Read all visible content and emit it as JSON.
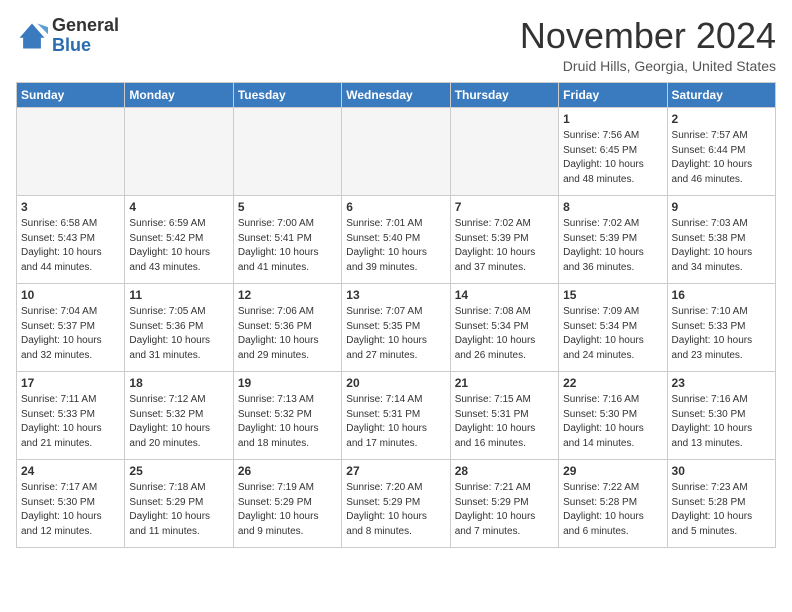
{
  "logo": {
    "general": "General",
    "blue": "Blue"
  },
  "header": {
    "month": "November 2024",
    "location": "Druid Hills, Georgia, United States"
  },
  "weekdays": [
    "Sunday",
    "Monday",
    "Tuesday",
    "Wednesday",
    "Thursday",
    "Friday",
    "Saturday"
  ],
  "weeks": [
    [
      {
        "day": null
      },
      {
        "day": null
      },
      {
        "day": null
      },
      {
        "day": null
      },
      {
        "day": null
      },
      {
        "day": 1,
        "sunrise": "7:56 AM",
        "sunset": "6:45 PM",
        "daylight": "10 hours and 48 minutes."
      },
      {
        "day": 2,
        "sunrise": "7:57 AM",
        "sunset": "6:44 PM",
        "daylight": "10 hours and 46 minutes."
      }
    ],
    [
      {
        "day": 3,
        "sunrise": "6:58 AM",
        "sunset": "5:43 PM",
        "daylight": "10 hours and 44 minutes."
      },
      {
        "day": 4,
        "sunrise": "6:59 AM",
        "sunset": "5:42 PM",
        "daylight": "10 hours and 43 minutes."
      },
      {
        "day": 5,
        "sunrise": "7:00 AM",
        "sunset": "5:41 PM",
        "daylight": "10 hours and 41 minutes."
      },
      {
        "day": 6,
        "sunrise": "7:01 AM",
        "sunset": "5:40 PM",
        "daylight": "10 hours and 39 minutes."
      },
      {
        "day": 7,
        "sunrise": "7:02 AM",
        "sunset": "5:39 PM",
        "daylight": "10 hours and 37 minutes."
      },
      {
        "day": 8,
        "sunrise": "7:02 AM",
        "sunset": "5:39 PM",
        "daylight": "10 hours and 36 minutes."
      },
      {
        "day": 9,
        "sunrise": "7:03 AM",
        "sunset": "5:38 PM",
        "daylight": "10 hours and 34 minutes."
      }
    ],
    [
      {
        "day": 10,
        "sunrise": "7:04 AM",
        "sunset": "5:37 PM",
        "daylight": "10 hours and 32 minutes."
      },
      {
        "day": 11,
        "sunrise": "7:05 AM",
        "sunset": "5:36 PM",
        "daylight": "10 hours and 31 minutes."
      },
      {
        "day": 12,
        "sunrise": "7:06 AM",
        "sunset": "5:36 PM",
        "daylight": "10 hours and 29 minutes."
      },
      {
        "day": 13,
        "sunrise": "7:07 AM",
        "sunset": "5:35 PM",
        "daylight": "10 hours and 27 minutes."
      },
      {
        "day": 14,
        "sunrise": "7:08 AM",
        "sunset": "5:34 PM",
        "daylight": "10 hours and 26 minutes."
      },
      {
        "day": 15,
        "sunrise": "7:09 AM",
        "sunset": "5:34 PM",
        "daylight": "10 hours and 24 minutes."
      },
      {
        "day": 16,
        "sunrise": "7:10 AM",
        "sunset": "5:33 PM",
        "daylight": "10 hours and 23 minutes."
      }
    ],
    [
      {
        "day": 17,
        "sunrise": "7:11 AM",
        "sunset": "5:33 PM",
        "daylight": "10 hours and 21 minutes."
      },
      {
        "day": 18,
        "sunrise": "7:12 AM",
        "sunset": "5:32 PM",
        "daylight": "10 hours and 20 minutes."
      },
      {
        "day": 19,
        "sunrise": "7:13 AM",
        "sunset": "5:32 PM",
        "daylight": "10 hours and 18 minutes."
      },
      {
        "day": 20,
        "sunrise": "7:14 AM",
        "sunset": "5:31 PM",
        "daylight": "10 hours and 17 minutes."
      },
      {
        "day": 21,
        "sunrise": "7:15 AM",
        "sunset": "5:31 PM",
        "daylight": "10 hours and 16 minutes."
      },
      {
        "day": 22,
        "sunrise": "7:16 AM",
        "sunset": "5:30 PM",
        "daylight": "10 hours and 14 minutes."
      },
      {
        "day": 23,
        "sunrise": "7:16 AM",
        "sunset": "5:30 PM",
        "daylight": "10 hours and 13 minutes."
      }
    ],
    [
      {
        "day": 24,
        "sunrise": "7:17 AM",
        "sunset": "5:30 PM",
        "daylight": "10 hours and 12 minutes."
      },
      {
        "day": 25,
        "sunrise": "7:18 AM",
        "sunset": "5:29 PM",
        "daylight": "10 hours and 11 minutes."
      },
      {
        "day": 26,
        "sunrise": "7:19 AM",
        "sunset": "5:29 PM",
        "daylight": "10 hours and 9 minutes."
      },
      {
        "day": 27,
        "sunrise": "7:20 AM",
        "sunset": "5:29 PM",
        "daylight": "10 hours and 8 minutes."
      },
      {
        "day": 28,
        "sunrise": "7:21 AM",
        "sunset": "5:29 PM",
        "daylight": "10 hours and 7 minutes."
      },
      {
        "day": 29,
        "sunrise": "7:22 AM",
        "sunset": "5:28 PM",
        "daylight": "10 hours and 6 minutes."
      },
      {
        "day": 30,
        "sunrise": "7:23 AM",
        "sunset": "5:28 PM",
        "daylight": "10 hours and 5 minutes."
      }
    ]
  ]
}
